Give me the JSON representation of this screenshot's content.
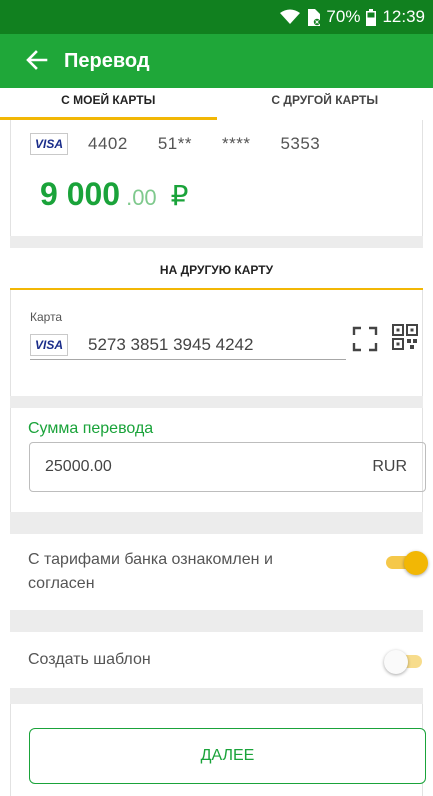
{
  "statusbar": {
    "battery_percent": "70%",
    "time": "12:39"
  },
  "appbar": {
    "back_icon": "arrow-left-icon",
    "title": "Перевод"
  },
  "tabs": [
    {
      "label": "С МОЕЙ КАРТЫ",
      "active": true
    },
    {
      "label": "С ДРУГОЙ КАРТЫ",
      "active": false
    }
  ],
  "source_card": {
    "brand": "VISA",
    "number_parts": [
      "4402",
      "51**",
      "****",
      "5353"
    ],
    "balance_int": "9 000",
    "balance_dec": ".00",
    "currency_symbol": "₽"
  },
  "destination": {
    "section_label": "НА ДРУГУЮ КАРТУ",
    "field_label": "Карта",
    "brand": "VISA",
    "card_number": "5273 3851 3945 4242"
  },
  "amount": {
    "label": "Сумма перевода",
    "value": "25000.00",
    "currency": "RUR"
  },
  "terms": {
    "label": "С тарифами банка ознакомлен и согласен",
    "checked": true
  },
  "template": {
    "label": "Создать шаблон",
    "checked": false
  },
  "next_button": {
    "label": "ДАЛЕЕ"
  },
  "colors": {
    "statusbar": "#11801f",
    "appbar": "#1fa739",
    "accent_green": "#1aa33a",
    "accent_yellow": "#f2b705"
  }
}
